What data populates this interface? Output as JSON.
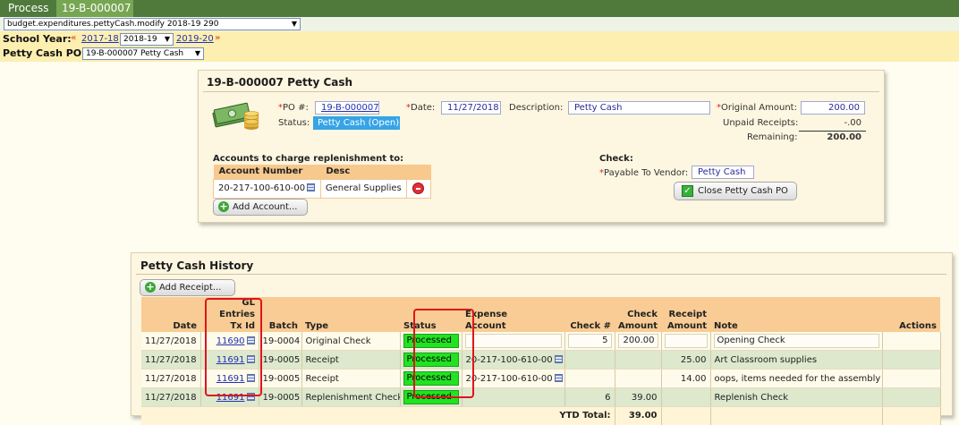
{
  "topbar": {
    "process_label": "Process",
    "record_id": "19-B-000007"
  },
  "module_select": "budget.expenditures.pettyCash.modify 2018-19 290",
  "school_year": {
    "label": "School Year:",
    "prev_arrow": "«",
    "prev": "2017-18",
    "current": "2018-19",
    "next": "2019-20",
    "next_arrow": "»"
  },
  "petty_cash_po": {
    "label": "Petty Cash PO:",
    "selected": "19-B-000007 Petty Cash"
  },
  "detail": {
    "title": "19-B-000007 Petty Cash",
    "po_label": "*PO #:",
    "po_value": "19-B-000007",
    "date_label": "*Date:",
    "date_value": "11/27/2018",
    "desc_label": "Description:",
    "desc_value": "Petty Cash",
    "status_label": "Status:",
    "status_value": "Petty Cash (Open)",
    "original_amount_label": "*Original Amount:",
    "original_amount": "200.00",
    "unpaid_receipts_label": "Unpaid Receipts:",
    "unpaid_receipts": "-.00",
    "remaining_label": "Remaining:",
    "remaining": "200.00",
    "accounts_heading": "Accounts to charge replenishment to:",
    "accounts_columns": [
      "Account Number",
      "Desc"
    ],
    "accounts_rows": [
      {
        "account": "20-217-100-610-00",
        "desc": "General Supplies"
      }
    ],
    "add_account_label": "Add Account...",
    "check_heading": "Check:",
    "payable_label": "*Payable To Vendor:",
    "payable_value": "Petty Cash",
    "close_button": "Close Petty Cash PO"
  },
  "history": {
    "title": "Petty Cash History",
    "add_receipt_label": "Add Receipt...",
    "columns": {
      "date": "Date",
      "gl1": "GL Entries",
      "gl2": "Tx Id",
      "batch": "Batch",
      "type": "Type",
      "status": "Status",
      "exp1": "Expense",
      "exp2": "Account",
      "check_no": "Check #",
      "chk1": "Check",
      "chk2": "Amount",
      "rec1": "Receipt",
      "rec2": "Amount",
      "note": "Note",
      "actions": "Actions"
    },
    "rows": [
      {
        "date": "11/27/2018",
        "tx": "11690",
        "batch": "19-0004",
        "type": "Original Check",
        "status": "Processed",
        "account": "",
        "check_no": "5",
        "check_amount": "200.00",
        "receipt_amount": "",
        "note": "Opening Check"
      },
      {
        "date": "11/27/2018",
        "tx": "11691",
        "batch": "19-0005",
        "type": "Receipt",
        "status": "Processed",
        "account": "20-217-100-610-00",
        "check_no": "",
        "check_amount": "",
        "receipt_amount": "25.00",
        "note": "Art Classroom supplies"
      },
      {
        "date": "11/27/2018",
        "tx": "11691",
        "batch": "19-0005",
        "type": "Receipt",
        "status": "Processed",
        "account": "20-217-100-610-00",
        "check_no": "",
        "check_amount": "",
        "receipt_amount": "14.00",
        "note": "oops, items needed for the assembly"
      },
      {
        "date": "11/27/2018",
        "tx": "11691",
        "batch": "19-0005",
        "type": "Replenishment Check",
        "status": "Processed",
        "account": "",
        "check_no": "6",
        "check_amount": "39.00",
        "receipt_amount": "",
        "note": "Replenish Check"
      }
    ],
    "ytd_label": "YTD Total:",
    "ytd_value": "39.00"
  },
  "colors": {
    "topbar": "#4f7a3c",
    "tab_active": "#77a653",
    "processed": "#22e322",
    "status_open": "#36a4e6",
    "highlight": "#e0141c"
  }
}
